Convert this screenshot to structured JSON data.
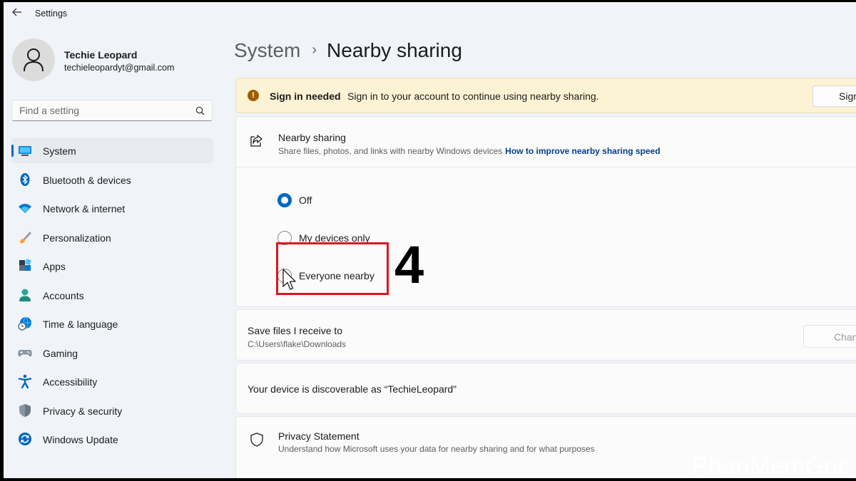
{
  "window": {
    "title": "Settings",
    "back_icon": "arrow-left-icon"
  },
  "profile": {
    "name": "Techie Leopard",
    "email": "techieleopardyt@gmail.com"
  },
  "search": {
    "placeholder": "Find a setting"
  },
  "sidebar": {
    "items": [
      {
        "label": "System",
        "icon": "system-icon",
        "active": true
      },
      {
        "label": "Bluetooth & devices",
        "icon": "bluetooth-icon"
      },
      {
        "label": "Network & internet",
        "icon": "wifi-icon"
      },
      {
        "label": "Personalization",
        "icon": "brush-icon"
      },
      {
        "label": "Apps",
        "icon": "apps-icon"
      },
      {
        "label": "Accounts",
        "icon": "account-icon"
      },
      {
        "label": "Time & language",
        "icon": "globe-clock-icon"
      },
      {
        "label": "Gaming",
        "icon": "gamepad-icon"
      },
      {
        "label": "Accessibility",
        "icon": "accessibility-icon"
      },
      {
        "label": "Privacy & security",
        "icon": "shield-icon"
      },
      {
        "label": "Windows Update",
        "icon": "update-icon"
      }
    ]
  },
  "breadcrumb": {
    "parent": "System",
    "separator": "›",
    "current": "Nearby sharing"
  },
  "banner": {
    "title": "Sign in needed",
    "text": "Sign in to your account to continue using nearby sharing.",
    "button": "Sign in",
    "color": "#fcf2d4"
  },
  "nearby_sharing": {
    "title": "Nearby sharing",
    "description": "Share files, photos, and links with nearby Windows devices",
    "link": "How to improve nearby sharing speed",
    "options": [
      {
        "label": "Off",
        "checked": true
      },
      {
        "label": "My devices only",
        "checked": false
      },
      {
        "label": "Everyone nearby",
        "checked": false
      }
    ]
  },
  "annotation": {
    "step": "4",
    "box_color": "#e0141e"
  },
  "save_files": {
    "title": "Save files I receive to",
    "path": "C:\\Users\\flake\\Downloads",
    "button": "Change"
  },
  "discoverable": {
    "text": "Your device is discoverable as “TechieLeopard”"
  },
  "privacy": {
    "title": "Privacy Statement",
    "description": "Understand how Microsoft uses your data for nearby sharing and for what purposes"
  },
  "watermark": "PhanMemGoc",
  "colors": {
    "accent": "#0067c0",
    "link": "#003e92",
    "warning": "#9d5d00"
  }
}
